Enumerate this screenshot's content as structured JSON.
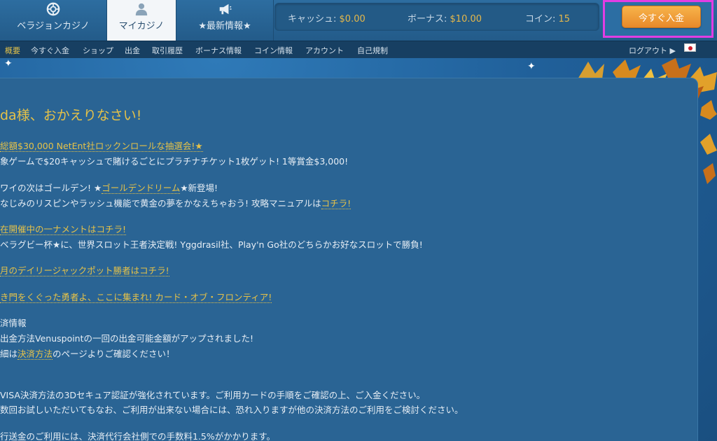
{
  "nav": {
    "tabs": [
      {
        "label": "ベラジョンカジノ",
        "icon": "casino-chip-icon"
      },
      {
        "label": "マイカジノ",
        "icon": "user-icon"
      },
      {
        "label": "★最新情報★",
        "icon": "megaphone-icon"
      }
    ]
  },
  "balance": {
    "cash_label": "キャッシュ:",
    "cash_value": "$0.00",
    "bonus_label": "ボーナス:",
    "bonus_value": "$10.00",
    "coin_label": "コイン:",
    "coin_value": "15"
  },
  "deposit_button": "今すぐ入金",
  "subnav": {
    "items": [
      "概要",
      "今すぐ入金",
      "ショップ",
      "出金",
      "取引履歴",
      "ボーナス情報",
      "コイン情報",
      "アカウント",
      "自己規制"
    ],
    "logout": "ログアウト ▶"
  },
  "content": {
    "greeting": "da様、おかえりなさい!",
    "news": [
      {
        "line1_link": "総額$30,000 NetEnt社ロックンロールな抽選会!★",
        "line2": "象ゲームで$20キャッシュで賭けるごとにプラチナチケット1枚ゲット! 1等賞金$3,000!"
      },
      {
        "line1_pre": "ワイの次はゴールデン! ★",
        "line1_link": "ゴールデンドリーム",
        "line1_post": "★新登場!",
        "line2_pre": "なじみのリスピンやラッシュ機能で黄金の夢をかなえちゃおう! 攻略マニュアルは",
        "line2_link": "コチラ!"
      },
      {
        "line1_link": "在開催中の一ナメントはコチラ!",
        "line2": "ベラグビー杯★に、世界スロット王者決定戦! Yggdrasil社、Play'n Go社のどちらかお好なスロットで勝負!"
      },
      {
        "line1_link": "月のデイリージャックポット勝者はコチラ!"
      },
      {
        "line1_link": "き門をくぐった勇者よ、ここに集まれ! カード・オブ・フロンティア!"
      }
    ],
    "payment": {
      "heading": "済情報",
      "line1": "出金方法Venuspointの一回の出金可能金額がアップされました!",
      "line2_pre": "細は",
      "line2_link": "決済方法",
      "line2_post": "のページよりご確認ください！",
      "line3": "VISA決済方法の3Dセキュア認証が強化されています。ご利用カードの手順をご確認の上、ご入金ください。",
      "line4": "数回お試しいただいてもなお、ご利用が出来ない場合には、恐れ入りますが他の決済方法のご利用をご検討ください。",
      "line5": "行送金のご利用には、決済代行会社側での手数料1.5%がかかります。"
    }
  },
  "colors": {
    "accent_gold": "#e6c248",
    "deposit_orange": "#f0a03a",
    "highlight_magenta": "#e23de4",
    "background_blue": "#2a6494"
  }
}
